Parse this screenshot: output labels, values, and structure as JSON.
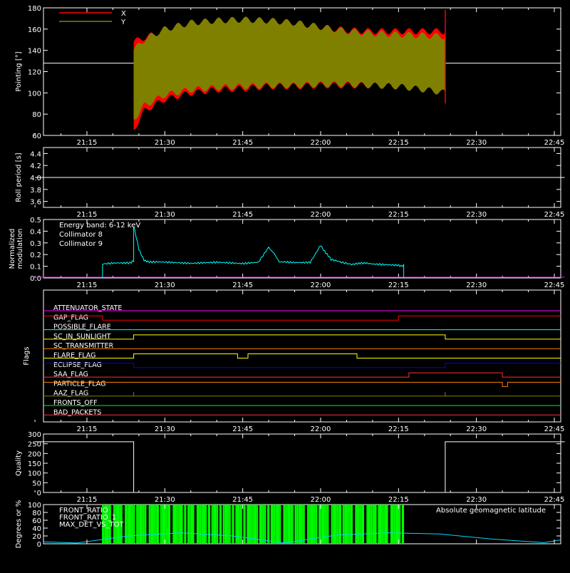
{
  "time_ticks": [
    "21:15",
    "21:30",
    "21:45",
    "22:00",
    "22:15",
    "22:30",
    "22:45"
  ],
  "colors": {
    "background": "#000000",
    "axis": "#ffffff",
    "x_series": "#ff0000",
    "y_series": "#808000",
    "roll": "#ffffff",
    "coll8": "#00ffff",
    "coll9": "#ff00ff",
    "geomag": "#00d8ff",
    "front_ratio_1": "#ffff00",
    "front_ratio_2": "#00ff00",
    "max_det": "#ff8000"
  },
  "chart_data": [
    {
      "type": "area",
      "panel": "pointing",
      "ylabel": "Pointing [°]",
      "ylim": [
        60,
        180
      ],
      "yticks": [
        60,
        80,
        100,
        120,
        140,
        160,
        180
      ],
      "xrange": [
        "21:05",
        "22:47"
      ],
      "legend_position": "top-left",
      "reference_line": 128,
      "series": [
        {
          "name": "X",
          "color": "#ff0000",
          "x": [
            "21:24",
            "21:26",
            "21:30",
            "21:35",
            "21:40",
            "21:45",
            "21:50",
            "21:55",
            "22:00",
            "22:05",
            "22:10",
            "22:15",
            "22:20",
            "22:24"
          ],
          "lower": [
            65,
            83,
            94,
            100,
            103,
            104,
            106,
            106,
            107,
            107,
            107,
            106,
            104,
            102
          ],
          "upper": [
            148,
            152,
            158,
            163,
            166,
            168,
            168,
            166,
            162,
            159,
            158,
            158,
            158,
            158
          ]
        },
        {
          "name": "Y",
          "color": "#808000",
          "x": [
            "21:24",
            "21:26",
            "21:30",
            "21:35",
            "21:40",
            "21:45",
            "21:50",
            "21:55",
            "22:00",
            "22:05",
            "22:10",
            "22:15",
            "22:20",
            "22:24"
          ],
          "lower": [
            75,
            88,
            98,
            103,
            105,
            106,
            107,
            107,
            108,
            108,
            107,
            106,
            103,
            100
          ],
          "upper": [
            140,
            150,
            160,
            166,
            168,
            169,
            168,
            166,
            162,
            158,
            156,
            155,
            154,
            153
          ]
        }
      ]
    },
    {
      "type": "line",
      "panel": "roll",
      "ylabel": "Roll period [s]",
      "ylim": [
        3.5,
        4.5
      ],
      "yticks": [
        "3.6",
        "3.8",
        "4.0",
        "4.2",
        "4.4"
      ],
      "series": [
        {
          "name": "",
          "x": [
            "21:05",
            "22:47"
          ],
          "y": [
            4.0,
            4.0
          ]
        }
      ]
    },
    {
      "type": "line",
      "panel": "modulation",
      "ylabel_line1": "Normalized",
      "ylabel_line2": "modulation",
      "ylim": [
        0,
        0.5
      ],
      "yticks": [
        "0.0",
        "0.1",
        "0.2",
        "0.3",
        "0.4",
        "0.5"
      ],
      "legend_title": "Energy band: 6-12 keV",
      "series": [
        {
          "name": "Collimator 8",
          "color": "#00ffff",
          "x": [
            "21:18",
            "21:18",
            "21:20",
            "21:23",
            "21:24",
            "21:24",
            "21:25",
            "21:26",
            "21:27",
            "21:30",
            "21:35",
            "21:40",
            "21:45",
            "21:48",
            "21:50",
            "21:51",
            "21:52",
            "21:55",
            "21:58",
            "22:00",
            "22:01",
            "22:02",
            "22:04",
            "22:06",
            "22:10",
            "22:15",
            "22:16",
            "22:16"
          ],
          "y": [
            0.0,
            0.12,
            0.12,
            0.13,
            0.15,
            0.45,
            0.24,
            0.16,
            0.13,
            0.13,
            0.12,
            0.13,
            0.12,
            0.14,
            0.26,
            0.22,
            0.13,
            0.13,
            0.14,
            0.28,
            0.22,
            0.15,
            0.13,
            0.12,
            0.12,
            0.11,
            0.11,
            0.0
          ]
        },
        {
          "name": "Collimator 9",
          "color": "#ff00ff",
          "x": [
            "21:05",
            "22:47"
          ],
          "y": [
            0.0,
            0.0
          ]
        }
      ]
    },
    {
      "type": "line",
      "panel": "flags",
      "ylabel": "Flags",
      "series": [
        {
          "name": "ATTENUATOR_STATE",
          "color": "#ff00ff",
          "steps": [
            [
              "21:05",
              0
            ]
          ]
        },
        {
          "name": "GAP_FLAG",
          "color": "#ff0000",
          "steps": [
            [
              "21:05",
              1
            ],
            [
              "21:18",
              0
            ],
            [
              "22:15",
              1
            ]
          ]
        },
        {
          "name": "POSSIBLE_FLARE",
          "color": "#00ffff",
          "steps": [
            [
              "21:05",
              0
            ]
          ]
        },
        {
          "name": "SC_IN_SUNLIGHT",
          "color": "#ffff00",
          "steps": [
            [
              "21:05",
              0
            ],
            [
              "21:24",
              1
            ],
            [
              "22:24",
              0
            ]
          ]
        },
        {
          "name": "SC_TRANSMITTER",
          "color": "#ff8000",
          "steps": [
            [
              "21:05",
              0
            ]
          ]
        },
        {
          "name": "FLARE_FLAG",
          "color": "#ffff00",
          "steps": [
            [
              "21:05",
              0
            ],
            [
              "21:24",
              1
            ],
            [
              "21:44",
              0
            ],
            [
              "21:46",
              1
            ],
            [
              "22:07",
              0
            ]
          ]
        },
        {
          "name": "ECLIPSE_FLAG",
          "color": "#0000ff",
          "steps": [
            [
              "21:05",
              1
            ],
            [
              "21:24",
              0
            ],
            [
              "22:24",
              1
            ]
          ]
        },
        {
          "name": "SAA_FLAG",
          "color": "#ff3030",
          "steps": [
            [
              "21:05",
              0
            ],
            [
              "22:17",
              1
            ],
            [
              "22:35",
              0
            ]
          ]
        },
        {
          "name": "PARTICLE_FLAG",
          "color": "#ff8000",
          "steps": [
            [
              "21:05",
              1
            ],
            [
              "22:35",
              0
            ],
            [
              "22:36",
              1
            ]
          ]
        },
        {
          "name": "AAZ_FLAG",
          "color": "#808000",
          "steps": [
            [
              "21:05",
              0
            ],
            [
              "21:24",
              1
            ],
            [
              "21:24",
              0
            ],
            [
              "22:24",
              1
            ],
            [
              "22:24",
              0
            ]
          ]
        },
        {
          "name": "FRONTS_OFF",
          "color": "#00ff00",
          "steps": [
            [
              "21:05",
              0
            ]
          ]
        },
        {
          "name": "BAD_PACKETS",
          "color": "#ff3030",
          "steps": [
            [
              "21:05",
              0
            ]
          ]
        }
      ]
    },
    {
      "type": "line",
      "panel": "quality",
      "ylabel": "Quality",
      "ylim": [
        0,
        300
      ],
      "yticks": [
        0,
        50,
        100,
        150,
        200,
        250,
        300
      ],
      "series": [
        {
          "name": "",
          "x": [
            "21:05",
            "21:24",
            "21:24",
            "22:24",
            "22:24",
            "22:47"
          ],
          "y": [
            260,
            260,
            0,
            0,
            260,
            260
          ]
        }
      ]
    },
    {
      "type": "bar",
      "panel": "front_ratio",
      "ylabel": "Degrees or %",
      "ylim": [
        0,
        100
      ],
      "yticks": [
        0,
        20,
        40,
        60,
        80,
        100
      ],
      "legend": [
        "FRONT_RATIO",
        "FRONT_RATIO_1",
        "MAX_DET_VS_TOT"
      ],
      "annotation": "Absolute geomagnetic latitude",
      "bars_range": [
        "21:18",
        "22:16"
      ],
      "bar_value": 100,
      "geomag_latitude": {
        "x": [
          "21:05",
          "21:13",
          "21:23",
          "21:33",
          "21:43",
          "21:53",
          "22:03",
          "22:13",
          "22:23",
          "22:33",
          "22:43",
          "22:47"
        ],
        "y": [
          5,
          2,
          20,
          28,
          20,
          2,
          22,
          28,
          25,
          12,
          3,
          10
        ]
      }
    }
  ]
}
